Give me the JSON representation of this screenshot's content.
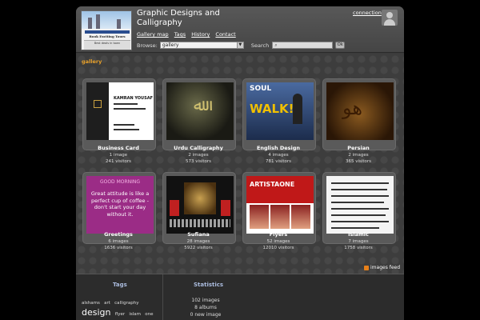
{
  "header": {
    "site_title": "Graphic Designs and Calligraphy",
    "menu": [
      "Gallery map",
      "Tags",
      "History",
      "Contact"
    ],
    "browse_label": "Browse:",
    "browse_value": "gallery",
    "search_label": "Search",
    "search_placeholder": "",
    "ok_label": "Ok",
    "connection_label": "connection",
    "logo": {
      "heading": "Book Exciting Tours",
      "sub": "Best deals in town"
    }
  },
  "content": {
    "gallery_label": "gallery",
    "categories": [
      {
        "name": "Business Card",
        "images": "1 image",
        "visitors": "241 visitors"
      },
      {
        "name": "Urdu Calligraphy",
        "images": "2 images",
        "visitors": "573 visitors"
      },
      {
        "name": "English Design",
        "images": "4 images",
        "visitors": "781 visitors"
      },
      {
        "name": "Persian",
        "images": "2 images",
        "visitors": "365 visitors"
      },
      {
        "name": "Greetings",
        "images": "6 images",
        "visitors": "1636 visitors"
      },
      {
        "name": "Sufiana",
        "images": "28 images",
        "visitors": "5922 visitors"
      },
      {
        "name": "Flyers",
        "images": "52 images",
        "visitors": "12010 visitors"
      },
      {
        "name": "Islamic",
        "images": "7 images",
        "visitors": "1758 visitors"
      }
    ],
    "thumb_text": {
      "business_card_name": "KAMRAN YOUSAF",
      "english_top": "SOUL",
      "english_word": "WALK!",
      "greet_top": "GOOD MORNING",
      "greet_msg": "Great attitude is like a perfect cup of coffee - don't start your day without it.",
      "flyers_brand": "ARTISTAONE"
    },
    "feed_label": "images feed"
  },
  "footer": {
    "tags_title": "Tags",
    "tags": [
      {
        "label": "alshams",
        "size": "small"
      },
      {
        "label": "art",
        "size": "small"
      },
      {
        "label": "calligraphy",
        "size": "small"
      },
      {
        "label": "design",
        "size": "large"
      },
      {
        "label": "flyer",
        "size": "small"
      },
      {
        "label": "islam",
        "size": "small"
      },
      {
        "label": "one",
        "size": "small"
      }
    ],
    "stats_title": "Statistics",
    "stats": [
      "102 images",
      "8 albums",
      "0 new image"
    ]
  },
  "colors": {
    "accent": "#e7a02a",
    "footer_heading": "#aabbdd",
    "background": "#000000",
    "panel": "#3d3d3d"
  }
}
